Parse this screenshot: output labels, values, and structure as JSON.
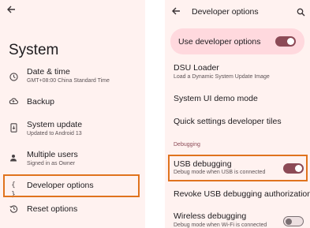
{
  "left": {
    "title": "System",
    "items": [
      {
        "label": "Date & time",
        "sub": "GMT+08:00 China Standard Time",
        "icon": "clock-icon"
      },
      {
        "label": "Backup",
        "sub": "",
        "icon": "cloud-upload-icon"
      },
      {
        "label": "System update",
        "sub": "Updated to Android 13",
        "icon": "system-update-icon"
      },
      {
        "label": "Multiple users",
        "sub": "Signed in as Owner",
        "icon": "person-icon"
      },
      {
        "label": "Developer options",
        "sub": "",
        "icon": "braces-icon"
      },
      {
        "label": "Reset options",
        "sub": "",
        "icon": "history-icon"
      }
    ],
    "braces_glyph": "{ }"
  },
  "right": {
    "title": "Developer options",
    "use_dev_label": "Use developer options",
    "use_dev_on": true,
    "items": [
      {
        "label": "DSU Loader",
        "sub": "Load a Dynamic System Update Image"
      },
      {
        "label": "System UI demo mode",
        "sub": ""
      },
      {
        "label": "Quick settings developer tiles",
        "sub": ""
      }
    ],
    "section": "Debugging",
    "usb": {
      "label": "USB debugging",
      "sub": "Debug mode when USB is connected",
      "on": true
    },
    "revoke": "Revoke USB debugging authorizations",
    "wireless": {
      "label": "Wireless debugging",
      "sub": "Debug mode when Wi-Fi is connected",
      "on": false
    }
  },
  "colors": {
    "highlight": "#e0731e",
    "toggle_on": "#8c4a56",
    "background": "#fff2f0"
  }
}
